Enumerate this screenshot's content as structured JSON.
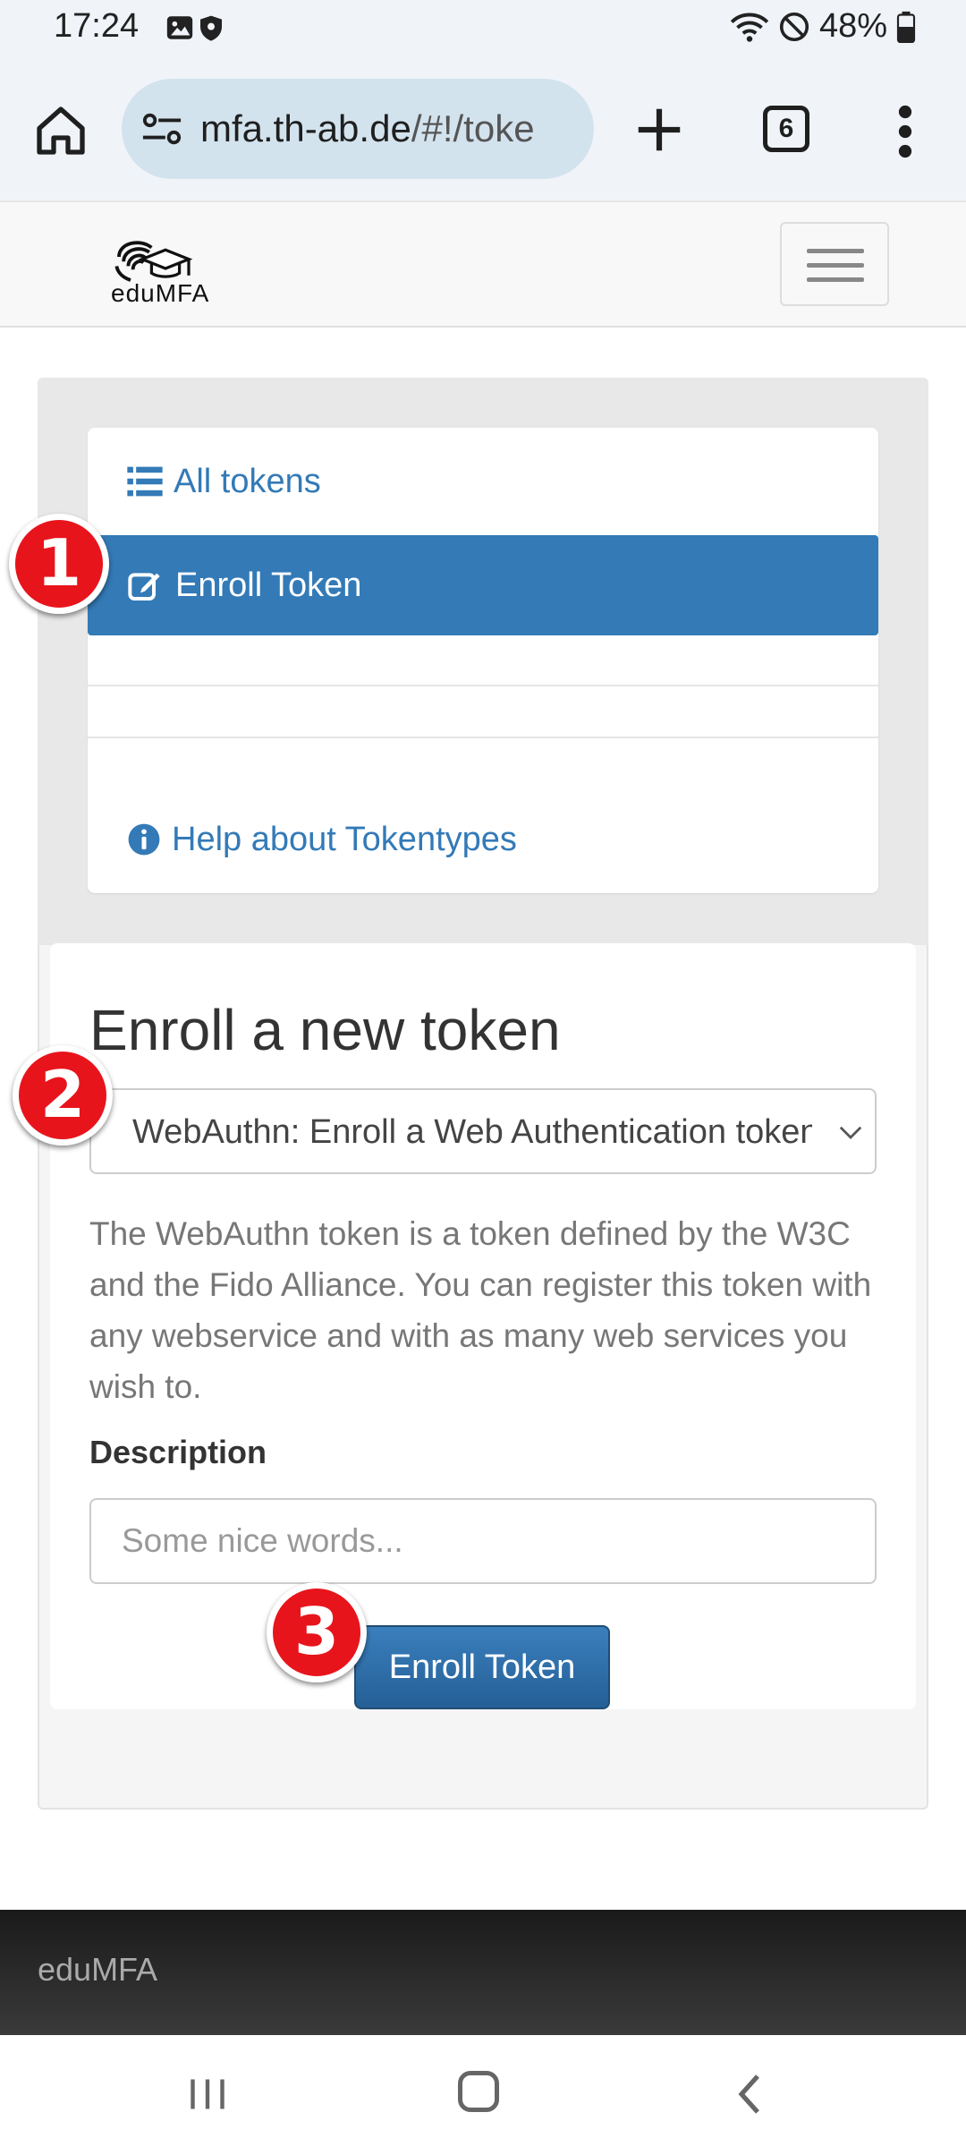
{
  "status_bar": {
    "time": "17:24",
    "battery": "48%",
    "icons": [
      "image-icon",
      "shield-icon",
      "wifi-icon",
      "do-not-disturb-icon",
      "battery-icon"
    ]
  },
  "browser": {
    "url_host": "mfa.th-ab.de",
    "url_path": "/#!/toke",
    "tab_count": "6",
    "icons": [
      "home-icon",
      "site-settings-icon",
      "new-tab-icon",
      "tabs-icon",
      "more-menu-icon"
    ]
  },
  "app": {
    "logo_text": "eduMFA",
    "accent_color": "#337ab7"
  },
  "menu": {
    "all_tokens": "All tokens",
    "enroll_token": "Enroll Token",
    "help_tokentypes": "Help about Tokentypes"
  },
  "main": {
    "heading": "Enroll a new token",
    "token_type_selected": "WebAuthn: Enroll a Web Authentication token",
    "description": "The WebAuthn token is a token defined by the W3C and the Fido Alliance. You can register this token with any webservice and with as many web services you wish to.",
    "description_label": "Description",
    "description_placeholder": "Some nice words...",
    "enroll_button": "Enroll Token"
  },
  "annotations": {
    "badge_1": "1",
    "badge_2": "2",
    "badge_3": "3",
    "badge_color": "#e8141c"
  },
  "footer": {
    "text": "eduMFA"
  }
}
